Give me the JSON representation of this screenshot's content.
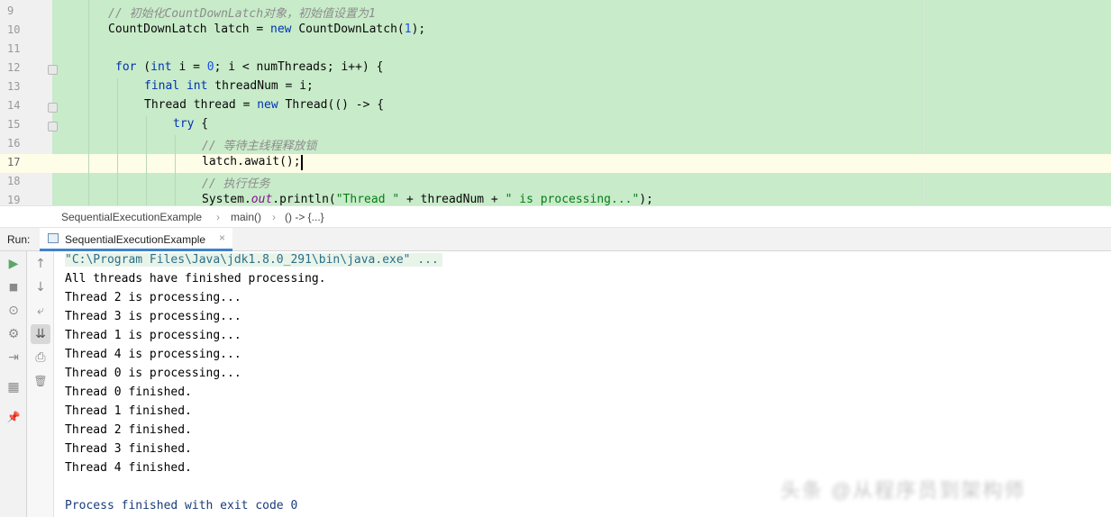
{
  "editor": {
    "line_numbers": [
      "9",
      "10",
      "11",
      "12",
      "13",
      "14",
      "15",
      "16",
      "17",
      "18",
      "19"
    ],
    "lines": {
      "l9": "// 初始化CountDownLatch对象，初始值设置为1",
      "l10_type": "CountDownLatch latch = ",
      "l10_new": "new",
      "l10_rest": " CountDownLatch(",
      "l10_num": "1",
      "l10_end": ");",
      "l12_for": "for",
      "l12_a": " (",
      "l12_int": "int",
      "l12_b": " i = ",
      "l12_zero": "0",
      "l12_c": "; i < numThreads; i++) {",
      "l13_final": "final",
      "l13_int": "int",
      "l13_rest": " threadNum = i;",
      "l14_a": "Thread thread = ",
      "l14_new": "new",
      "l14_b": " Thread(() -> {",
      "l15_try": "try",
      "l15_b": " {",
      "l16": "// 等待主线程释放锁",
      "l17": "latch.await();",
      "l18": "// 执行任务",
      "l19_a": "System.",
      "l19_out": "out",
      "l19_b": ".println(",
      "l19_s1": "\"Thread \"",
      "l19_c": " + threadNum + ",
      "l19_s2": "\" is processing...\"",
      "l19_d": ");"
    }
  },
  "breadcrumb": {
    "class": "SequentialExecutionExample",
    "method": "main()",
    "lambda": "() -> {...}",
    "separator": "›"
  },
  "run_panel": {
    "label": "Run:",
    "tab_label": "SequentialExecutionExample",
    "close_glyph": "×"
  },
  "console": {
    "lines": [
      "\"C:\\Program Files\\Java\\jdk1.8.0_291\\bin\\java.exe\" ...",
      "All threads have finished processing.",
      "Thread 2 is processing...",
      "Thread 3 is processing...",
      "Thread 1 is processing...",
      "Thread 4 is processing...",
      "Thread 0 is processing...",
      "Thread 0 finished.",
      "Thread 1 finished.",
      "Thread 2 finished.",
      "Thread 3 finished.",
      "Thread 4 finished.",
      "",
      "Process finished with exit code 0"
    ]
  },
  "toolbar_icons": {
    "rerun": "▶",
    "stop": "■",
    "snapshot": "⊙",
    "settings": "⚙",
    "exit": "⇥",
    "layout": "▦",
    "pin": "📌",
    "up": "↑",
    "down": "↓",
    "wrap": "⤶",
    "scroll_end": "⇊",
    "print": "⎙",
    "trash": "🗑"
  },
  "watermark": "头条 @从程序员到架构师",
  "colors": {
    "code_bg": "#c8ebc9",
    "current_line": "#fdfde8",
    "keyword": "#0033b3",
    "comment": "#8c8c8c",
    "string": "#067d17",
    "tab_underline": "#4083c9"
  }
}
